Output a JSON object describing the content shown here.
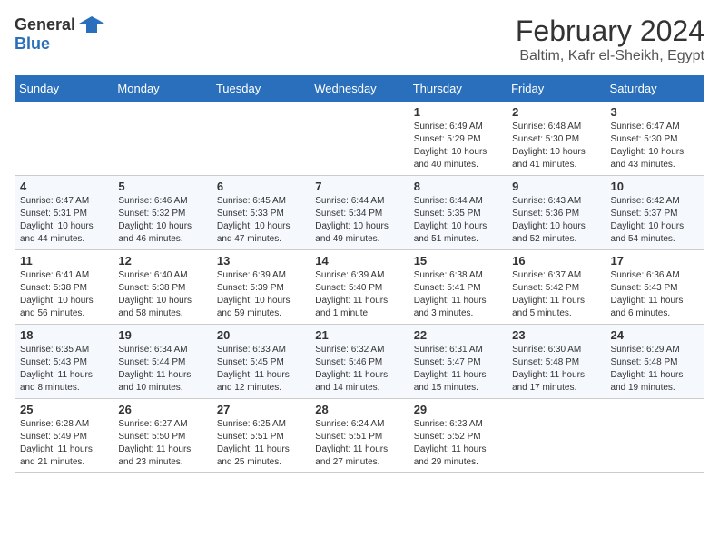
{
  "header": {
    "logo_general": "General",
    "logo_blue": "Blue",
    "month_title": "February 2024",
    "location": "Baltim, Kafr el-Sheikh, Egypt"
  },
  "weekdays": [
    "Sunday",
    "Monday",
    "Tuesday",
    "Wednesday",
    "Thursday",
    "Friday",
    "Saturday"
  ],
  "weeks": [
    [
      {
        "day": "",
        "info": ""
      },
      {
        "day": "",
        "info": ""
      },
      {
        "day": "",
        "info": ""
      },
      {
        "day": "",
        "info": ""
      },
      {
        "day": "1",
        "info": "Sunrise: 6:49 AM\nSunset: 5:29 PM\nDaylight: 10 hours\nand 40 minutes."
      },
      {
        "day": "2",
        "info": "Sunrise: 6:48 AM\nSunset: 5:30 PM\nDaylight: 10 hours\nand 41 minutes."
      },
      {
        "day": "3",
        "info": "Sunrise: 6:47 AM\nSunset: 5:30 PM\nDaylight: 10 hours\nand 43 minutes."
      }
    ],
    [
      {
        "day": "4",
        "info": "Sunrise: 6:47 AM\nSunset: 5:31 PM\nDaylight: 10 hours\nand 44 minutes."
      },
      {
        "day": "5",
        "info": "Sunrise: 6:46 AM\nSunset: 5:32 PM\nDaylight: 10 hours\nand 46 minutes."
      },
      {
        "day": "6",
        "info": "Sunrise: 6:45 AM\nSunset: 5:33 PM\nDaylight: 10 hours\nand 47 minutes."
      },
      {
        "day": "7",
        "info": "Sunrise: 6:44 AM\nSunset: 5:34 PM\nDaylight: 10 hours\nand 49 minutes."
      },
      {
        "day": "8",
        "info": "Sunrise: 6:44 AM\nSunset: 5:35 PM\nDaylight: 10 hours\nand 51 minutes."
      },
      {
        "day": "9",
        "info": "Sunrise: 6:43 AM\nSunset: 5:36 PM\nDaylight: 10 hours\nand 52 minutes."
      },
      {
        "day": "10",
        "info": "Sunrise: 6:42 AM\nSunset: 5:37 PM\nDaylight: 10 hours\nand 54 minutes."
      }
    ],
    [
      {
        "day": "11",
        "info": "Sunrise: 6:41 AM\nSunset: 5:38 PM\nDaylight: 10 hours\nand 56 minutes."
      },
      {
        "day": "12",
        "info": "Sunrise: 6:40 AM\nSunset: 5:38 PM\nDaylight: 10 hours\nand 58 minutes."
      },
      {
        "day": "13",
        "info": "Sunrise: 6:39 AM\nSunset: 5:39 PM\nDaylight: 10 hours\nand 59 minutes."
      },
      {
        "day": "14",
        "info": "Sunrise: 6:39 AM\nSunset: 5:40 PM\nDaylight: 11 hours\nand 1 minute."
      },
      {
        "day": "15",
        "info": "Sunrise: 6:38 AM\nSunset: 5:41 PM\nDaylight: 11 hours\nand 3 minutes."
      },
      {
        "day": "16",
        "info": "Sunrise: 6:37 AM\nSunset: 5:42 PM\nDaylight: 11 hours\nand 5 minutes."
      },
      {
        "day": "17",
        "info": "Sunrise: 6:36 AM\nSunset: 5:43 PM\nDaylight: 11 hours\nand 6 minutes."
      }
    ],
    [
      {
        "day": "18",
        "info": "Sunrise: 6:35 AM\nSunset: 5:43 PM\nDaylight: 11 hours\nand 8 minutes."
      },
      {
        "day": "19",
        "info": "Sunrise: 6:34 AM\nSunset: 5:44 PM\nDaylight: 11 hours\nand 10 minutes."
      },
      {
        "day": "20",
        "info": "Sunrise: 6:33 AM\nSunset: 5:45 PM\nDaylight: 11 hours\nand 12 minutes."
      },
      {
        "day": "21",
        "info": "Sunrise: 6:32 AM\nSunset: 5:46 PM\nDaylight: 11 hours\nand 14 minutes."
      },
      {
        "day": "22",
        "info": "Sunrise: 6:31 AM\nSunset: 5:47 PM\nDaylight: 11 hours\nand 15 minutes."
      },
      {
        "day": "23",
        "info": "Sunrise: 6:30 AM\nSunset: 5:48 PM\nDaylight: 11 hours\nand 17 minutes."
      },
      {
        "day": "24",
        "info": "Sunrise: 6:29 AM\nSunset: 5:48 PM\nDaylight: 11 hours\nand 19 minutes."
      }
    ],
    [
      {
        "day": "25",
        "info": "Sunrise: 6:28 AM\nSunset: 5:49 PM\nDaylight: 11 hours\nand 21 minutes."
      },
      {
        "day": "26",
        "info": "Sunrise: 6:27 AM\nSunset: 5:50 PM\nDaylight: 11 hours\nand 23 minutes."
      },
      {
        "day": "27",
        "info": "Sunrise: 6:25 AM\nSunset: 5:51 PM\nDaylight: 11 hours\nand 25 minutes."
      },
      {
        "day": "28",
        "info": "Sunrise: 6:24 AM\nSunset: 5:51 PM\nDaylight: 11 hours\nand 27 minutes."
      },
      {
        "day": "29",
        "info": "Sunrise: 6:23 AM\nSunset: 5:52 PM\nDaylight: 11 hours\nand 29 minutes."
      },
      {
        "day": "",
        "info": ""
      },
      {
        "day": "",
        "info": ""
      }
    ]
  ]
}
